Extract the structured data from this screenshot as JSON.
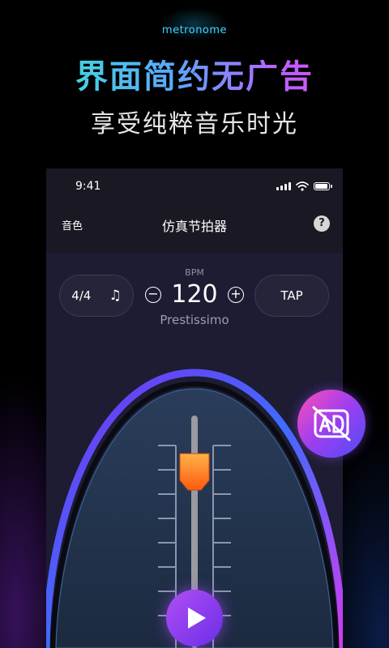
{
  "promo": {
    "app_name": "metronome",
    "headline": "界面简约无广告",
    "subline": "享受纯粹音乐时光"
  },
  "status_bar": {
    "time": "9:41"
  },
  "nav": {
    "left_label": "音色",
    "title": "仿真节拍器",
    "help_label": "?"
  },
  "controls": {
    "time_signature": "4/4",
    "note_icon": "♫",
    "bpm_label": "BPM",
    "bpm_value": "120",
    "minus_symbol": "−",
    "plus_symbol": "+",
    "tempo_name": "Prestissimo",
    "tap_label": "TAP"
  },
  "icons": {
    "note": "music-note-icon",
    "play": "play-icon",
    "ad": "no-ad-icon",
    "help": "question-icon",
    "wifi": "wifi-icon",
    "signal": "signal-icon",
    "battery": "battery-icon"
  },
  "colors": {
    "headline_gradient": [
      "#38f0c8",
      "#5aa8ff",
      "#c35bff",
      "#ff55d8"
    ],
    "app_name": "#3fd3ff",
    "phone_bg": "#1d1c32",
    "pendulum_weight": "#ff8a1e",
    "play_button": "#8b3cf0",
    "ring_gradient": [
      "#6a2ee6",
      "#3c6cff",
      "#c23cf0"
    ]
  }
}
